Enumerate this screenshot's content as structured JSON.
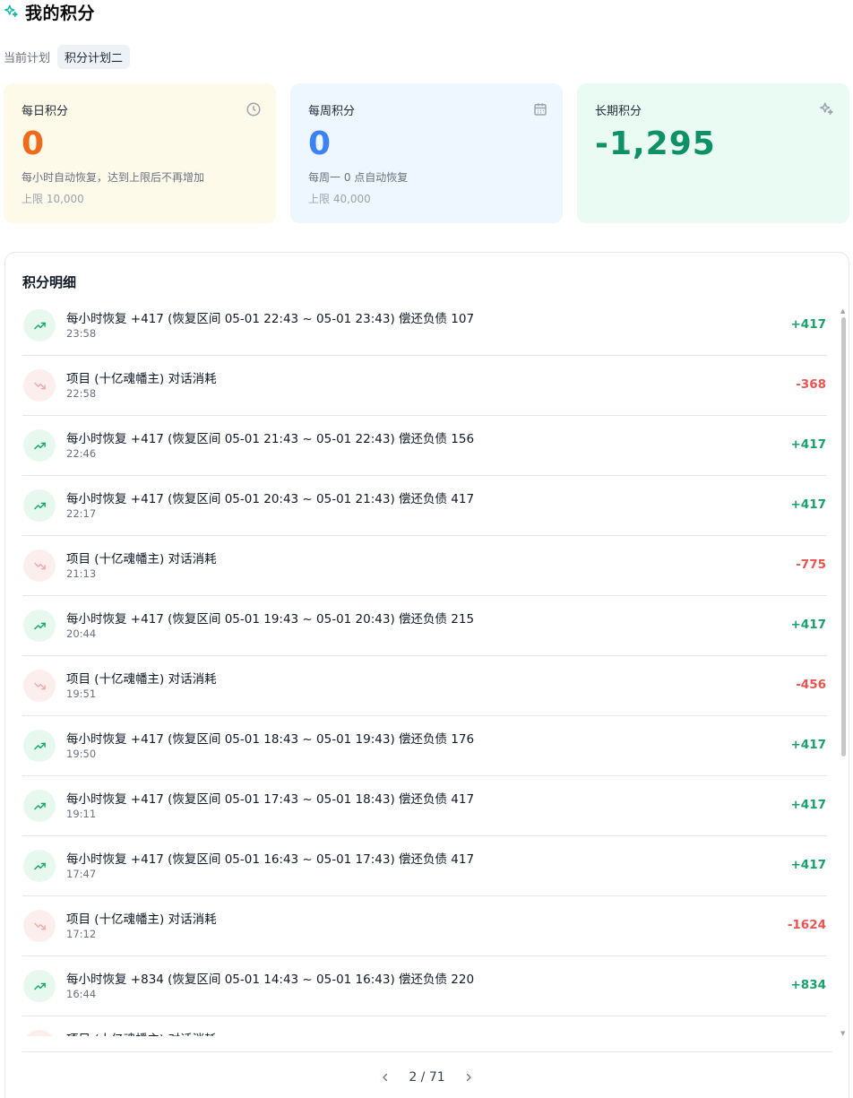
{
  "header": {
    "title": "我的积分",
    "icon": "sparkles-icon"
  },
  "plan": {
    "label": "当前计划",
    "current": "积分计划二"
  },
  "cards": {
    "daily": {
      "title": "每日积分",
      "value": "0",
      "desc": "每小时自动恢复，达到上限后不再增加",
      "limit": "上限 10,000",
      "icon": "clock-icon",
      "color": "#f06a1c"
    },
    "weekly": {
      "title": "每周积分",
      "value": "0",
      "desc": "每周一 0 点自动恢复",
      "limit": "上限 40,000",
      "icon": "calendar-icon",
      "color": "#3b82f6"
    },
    "longterm": {
      "title": "长期积分",
      "value": "-1,295",
      "icon": "sparkles-icon",
      "color": "#0f9168"
    }
  },
  "detail": {
    "title": "积分明细",
    "rows": [
      {
        "type": "up",
        "desc": "每小时恢复 +417 (恢复区间 05-01 22:43 ~ 05-01 23:43) 偿还负债 107",
        "time": "23:58",
        "amount": "+417"
      },
      {
        "type": "down",
        "desc": "项目 (十亿魂幡主) 对话消耗",
        "time": "22:58",
        "amount": "-368"
      },
      {
        "type": "up",
        "desc": "每小时恢复 +417 (恢复区间 05-01 21:43 ~ 05-01 22:43) 偿还负债 156",
        "time": "22:46",
        "amount": "+417"
      },
      {
        "type": "up",
        "desc": "每小时恢复 +417 (恢复区间 05-01 20:43 ~ 05-01 21:43) 偿还负债 417",
        "time": "22:17",
        "amount": "+417"
      },
      {
        "type": "down",
        "desc": "项目 (十亿魂幡主) 对话消耗",
        "time": "21:13",
        "amount": "-775"
      },
      {
        "type": "up",
        "desc": "每小时恢复 +417 (恢复区间 05-01 19:43 ~ 05-01 20:43) 偿还负债 215",
        "time": "20:44",
        "amount": "+417"
      },
      {
        "type": "down",
        "desc": "项目 (十亿魂幡主) 对话消耗",
        "time": "19:51",
        "amount": "-456"
      },
      {
        "type": "up",
        "desc": "每小时恢复 +417 (恢复区间 05-01 18:43 ~ 05-01 19:43) 偿还负债 176",
        "time": "19:50",
        "amount": "+417"
      },
      {
        "type": "up",
        "desc": "每小时恢复 +417 (恢复区间 05-01 17:43 ~ 05-01 18:43) 偿还负债 417",
        "time": "19:11",
        "amount": "+417"
      },
      {
        "type": "up",
        "desc": "每小时恢复 +417 (恢复区间 05-01 16:43 ~ 05-01 17:43) 偿还负债 417",
        "time": "17:47",
        "amount": "+417"
      },
      {
        "type": "down",
        "desc": "项目 (十亿魂幡主) 对话消耗",
        "time": "17:12",
        "amount": "-1624"
      },
      {
        "type": "up",
        "desc": "每小时恢复 +834 (恢复区间 05-01 14:43 ~ 05-01 16:43) 偿还负债 220",
        "time": "16:44",
        "amount": "+834"
      },
      {
        "type": "down",
        "desc": "项目 (十亿魂幡主) 对话消耗",
        "time": "",
        "amount": ""
      }
    ]
  },
  "pager": {
    "text": "2 / 71",
    "prev_icon": "chevron-left-icon",
    "next_icon": "chevron-right-icon"
  }
}
